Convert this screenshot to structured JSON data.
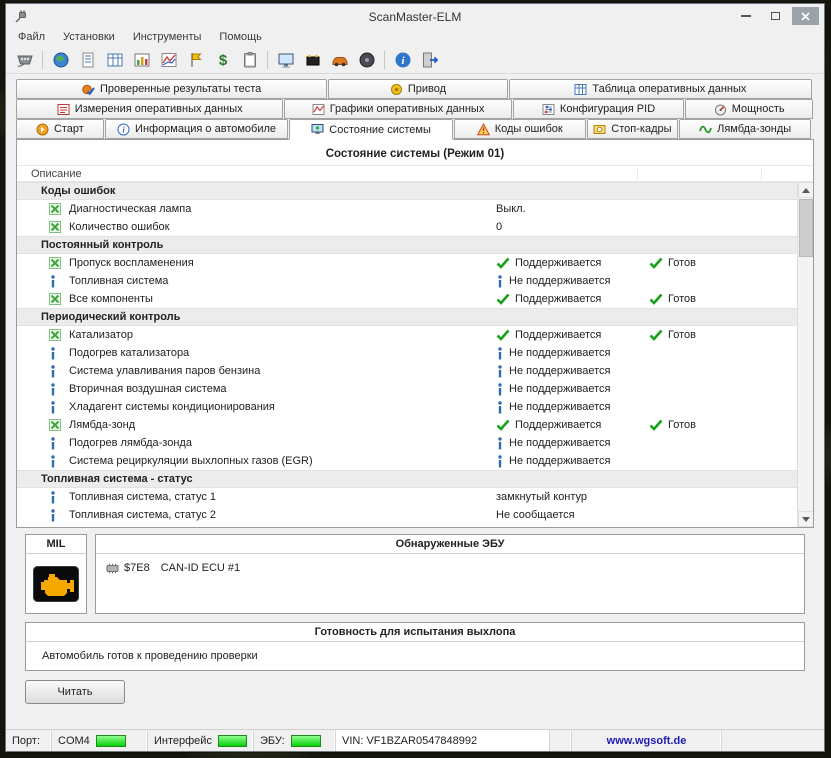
{
  "window": {
    "title": "ScanMaster-ELM"
  },
  "menu": {
    "items": [
      {
        "label": "Файл"
      },
      {
        "label": "Установки"
      },
      {
        "label": "Инструменты"
      },
      {
        "label": "Помощь"
      }
    ]
  },
  "toolbar": {
    "icons": [
      "obd-connector",
      "globe",
      "report",
      "data-table",
      "chart-table",
      "graph",
      "flag",
      "currency",
      "clipboard",
      "monitor",
      "battery",
      "vehicle",
      "disc",
      "info",
      "exit"
    ]
  },
  "tabs": {
    "row1": [
      {
        "label": "Проверенные результаты теста"
      },
      {
        "label": "Привод"
      },
      {
        "label": "Таблица оперативных данных"
      }
    ],
    "row2": [
      {
        "label": "Измерения оперативных данных"
      },
      {
        "label": "Графики оперативных данных"
      },
      {
        "label": "Конфигурация PID"
      },
      {
        "label": "Мощность"
      }
    ],
    "row3": [
      {
        "label": "Старт"
      },
      {
        "label": "Информация о автомобиле"
      },
      {
        "label": "Состояние системы",
        "active": true
      },
      {
        "label": "Коды ошибок"
      },
      {
        "label": "Стоп-кадры"
      },
      {
        "label": "Лямбда-зонды"
      }
    ]
  },
  "system_status": {
    "title": "Состояние системы (Режим 01)",
    "column_header": "Описание",
    "rows": [
      {
        "type": "section",
        "label": "Коды ошибок"
      },
      {
        "type": "item",
        "icon": "green",
        "desc": "Диагностическая лампа",
        "status": "Выкл."
      },
      {
        "type": "item",
        "icon": "green",
        "desc": "Количество ошибок",
        "status": "0"
      },
      {
        "type": "section",
        "label": "Постоянный контроль"
      },
      {
        "type": "item",
        "icon": "green",
        "desc": "Пропуск воспламенения",
        "status_icon": "check",
        "status": "Поддерживается",
        "ready_icon": "check",
        "ready": "Готов"
      },
      {
        "type": "item",
        "icon": "info",
        "desc": "Топливная система",
        "status_icon": "info",
        "status": "Не поддерживается"
      },
      {
        "type": "item",
        "icon": "green",
        "desc": "Все компоненты",
        "status_icon": "check",
        "status": "Поддерживается",
        "ready_icon": "check",
        "ready": "Готов"
      },
      {
        "type": "section",
        "label": "Периодический контроль"
      },
      {
        "type": "item",
        "icon": "green",
        "desc": "Катализатор",
        "status_icon": "check",
        "status": "Поддерживается",
        "ready_icon": "check",
        "ready": "Готов"
      },
      {
        "type": "item",
        "icon": "info",
        "desc": "Подогрев катализатора",
        "status_icon": "info",
        "status": "Не поддерживается"
      },
      {
        "type": "item",
        "icon": "info",
        "desc": "Система улавливания паров бензина",
        "status_icon": "info",
        "status": "Не поддерживается"
      },
      {
        "type": "item",
        "icon": "info",
        "desc": "Вторичная воздушная система",
        "status_icon": "info",
        "status": "Не поддерживается"
      },
      {
        "type": "item",
        "icon": "info",
        "desc": "Хладагент системы кондиционирования",
        "status_icon": "info",
        "status": "Не поддерживается"
      },
      {
        "type": "item",
        "icon": "green",
        "desc": "Лямбда-зонд",
        "status_icon": "check",
        "status": "Поддерживается",
        "ready_icon": "check",
        "ready": "Готов"
      },
      {
        "type": "item",
        "icon": "info",
        "desc": "Подогрев лямбда-зонда",
        "status_icon": "info",
        "status": "Не поддерживается"
      },
      {
        "type": "item",
        "icon": "info",
        "desc": "Система рециркуляции выхлопных газов (EGR)",
        "status_icon": "info",
        "status": "Не поддерживается"
      },
      {
        "type": "section",
        "label": "Топливная система - статус"
      },
      {
        "type": "item",
        "icon": "info",
        "desc": "Топливная система, статус 1",
        "status": "замкнутый контур"
      },
      {
        "type": "item",
        "icon": "info",
        "desc": "Топливная система, статус 2",
        "status": "Не сообщается"
      }
    ]
  },
  "mil": {
    "title": "MIL"
  },
  "ecu": {
    "title": "Обнаруженные ЭБУ",
    "entries": [
      {
        "id": "$7E8",
        "label": "CAN-ID ECU #1"
      }
    ]
  },
  "readiness": {
    "title": "Готовность для испытания выхлопа",
    "message": "Автомобиль готов к проведению проверки"
  },
  "buttons": {
    "read": "Читать"
  },
  "statusbar": {
    "port_label": "Порт:",
    "port_value": "COM4",
    "interface_label": "Интерфейс",
    "ecu_label": "ЭБУ:",
    "vin": "VIN: VF1BZAR0547848992",
    "link": "www.wgsoft.de"
  },
  "colors": {
    "led_green": "#0acf0a",
    "check_green": "#18a018",
    "link_blue": "#1f1fb4",
    "mil_amber": "#f5a800"
  }
}
